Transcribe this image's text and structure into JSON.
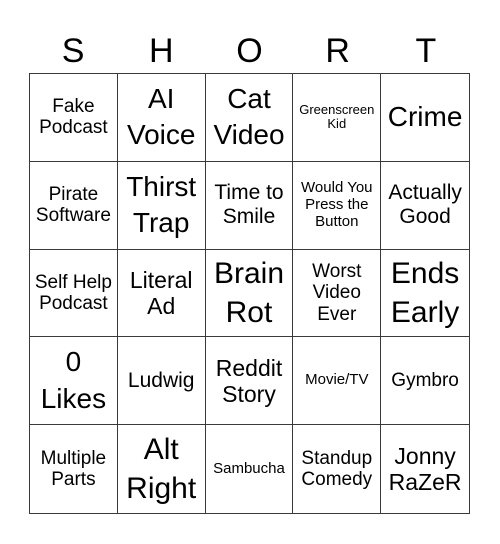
{
  "title_letters": [
    "S",
    "H",
    "O",
    "R",
    "T"
  ],
  "cells": [
    "Fake Podcast",
    "AI Voice",
    "Cat Video",
    "Greenscreen Kid",
    "Crime",
    "Pirate Software",
    "Thirst Trap",
    "Time to Smile",
    "Would You Press the Button",
    "Actually Good",
    "Self Help Podcast",
    "Literal Ad",
    "Brain Rot",
    "Worst Video Ever",
    "Ends Early",
    "0 Likes",
    "Ludwig",
    "Reddit Story",
    "Movie/TV",
    "Gymbro",
    "Multiple Parts",
    "Alt Right",
    "Sambucha",
    "Standup Comedy",
    "Jonny RaZeR"
  ]
}
